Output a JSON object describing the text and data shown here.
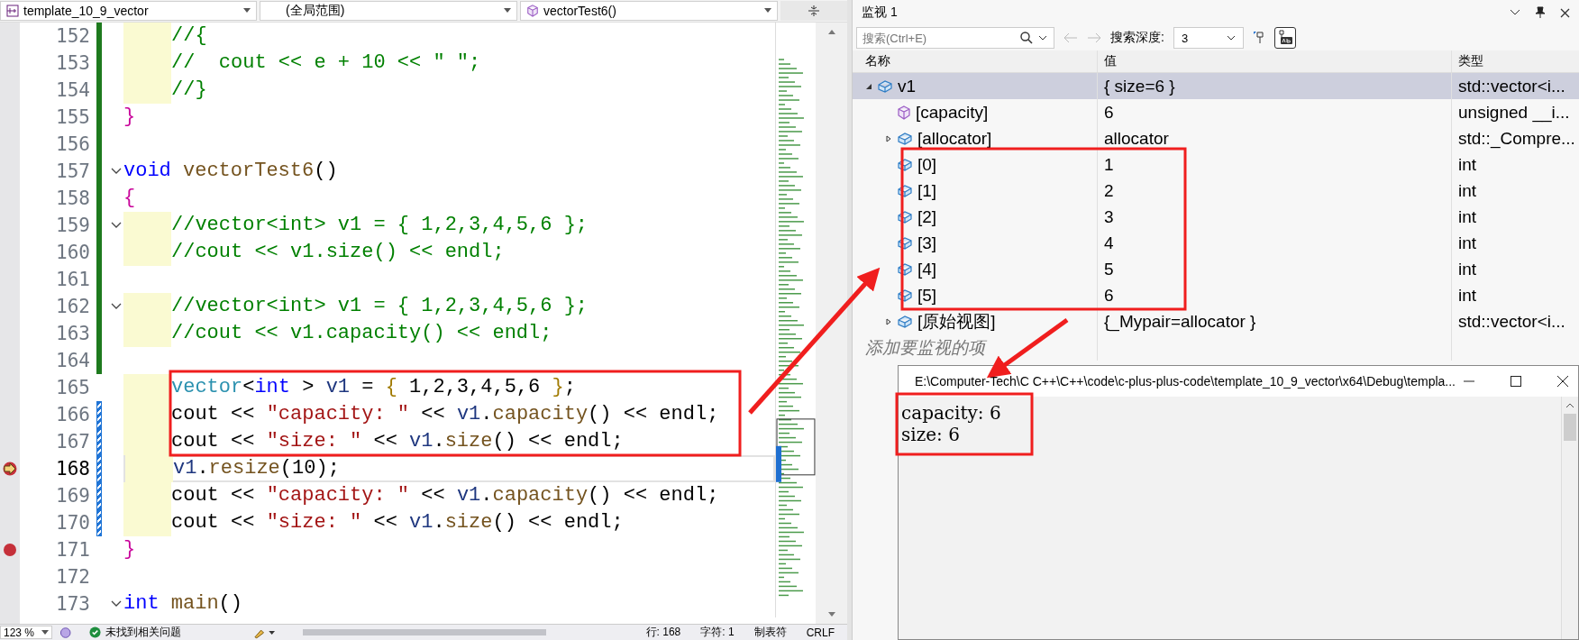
{
  "editor": {
    "nav": {
      "project": "template_10_9_vector",
      "scope": "(全局范围)",
      "member": "vectorTest6()"
    },
    "lines": [
      {
        "number": "152",
        "breakpoint": false,
        "changed": true,
        "saved": true,
        "fold": false,
        "indented": true,
        "current": false,
        "tokens": [
          {
            "kind": "comment",
            "text": "//{"
          }
        ]
      },
      {
        "number": "153",
        "breakpoint": false,
        "changed": true,
        "saved": true,
        "fold": false,
        "indented": true,
        "current": false,
        "tokens": [
          {
            "kind": "comment",
            "text": "//  cout << e + 10 << \" \";"
          }
        ]
      },
      {
        "number": "154",
        "breakpoint": false,
        "changed": true,
        "saved": true,
        "fold": false,
        "indented": true,
        "current": false,
        "tokens": [
          {
            "kind": "comment",
            "text": "//}"
          }
        ]
      },
      {
        "number": "155",
        "breakpoint": false,
        "changed": true,
        "saved": true,
        "fold": false,
        "indented": false,
        "current": false,
        "tokens": [
          {
            "kind": "brace",
            "text": "}"
          }
        ]
      },
      {
        "number": "156",
        "breakpoint": false,
        "changed": true,
        "saved": true,
        "fold": false,
        "indented": false,
        "current": false
      },
      {
        "number": "157",
        "breakpoint": false,
        "changed": true,
        "saved": true,
        "fold": true,
        "indented": false,
        "current": false,
        "tokens": [
          {
            "kind": "keyword",
            "text": "void"
          },
          {
            "kind": "function",
            "text": "vectorTest6"
          },
          {
            "kind": "plain",
            "text": "()"
          }
        ]
      },
      {
        "number": "158",
        "breakpoint": false,
        "changed": true,
        "saved": true,
        "fold": false,
        "indented": false,
        "current": false,
        "tokens": [
          {
            "kind": "brace",
            "text": "{"
          }
        ]
      },
      {
        "number": "159",
        "breakpoint": false,
        "changed": true,
        "saved": true,
        "fold": true,
        "indented": true,
        "current": false,
        "tokens": [
          {
            "kind": "comment",
            "text": "//vector<int> v1 = { 1,2,3,4,5,6 };"
          }
        ]
      },
      {
        "number": "160",
        "breakpoint": false,
        "changed": true,
        "saved": true,
        "fold": false,
        "indented": true,
        "current": false,
        "tokens": [
          {
            "kind": "comment",
            "text": "//cout << v1.size() << endl;"
          }
        ]
      },
      {
        "number": "161",
        "breakpoint": false,
        "changed": true,
        "saved": true,
        "fold": false,
        "indented": false,
        "current": false
      },
      {
        "number": "162",
        "breakpoint": false,
        "changed": true,
        "saved": true,
        "fold": true,
        "indented": true,
        "current": false,
        "tokens": [
          {
            "kind": "comment",
            "text": "//vector<int> v1 = { 1,2,3,4,5,6 };"
          }
        ]
      },
      {
        "number": "163",
        "breakpoint": false,
        "changed": true,
        "saved": true,
        "fold": false,
        "indented": true,
        "current": false,
        "tokens": [
          {
            "kind": "comment",
            "text": "//cout << v1.capacity() << endl;"
          }
        ]
      },
      {
        "number": "164",
        "breakpoint": false,
        "changed": true,
        "saved": true,
        "fold": false,
        "indented": false,
        "current": false
      },
      {
        "number": "165",
        "breakpoint": false,
        "changed": false,
        "fold": false,
        "indented": true,
        "current": false,
        "tokens": [
          {
            "kind": "type",
            "text": "vector"
          },
          {
            "kind": "plain",
            "text": "<"
          },
          {
            "kind": "keyword",
            "text": "int"
          },
          {
            "kind": "plain",
            "text": "> "
          },
          {
            "kind": "variable",
            "text": "v1"
          },
          {
            "kind": "plain",
            "text": " = "
          },
          {
            "kind": "init",
            "text": "{"
          },
          {
            "kind": "plain",
            "text": " 1,2,3,4,5,6 "
          },
          {
            "kind": "init",
            "text": "}"
          },
          {
            "kind": "plain",
            "text": ";"
          }
        ]
      },
      {
        "number": "166",
        "breakpoint": false,
        "changed": true,
        "saved": false,
        "fold": false,
        "indented": true,
        "current": false,
        "tokens": [
          {
            "kind": "plain",
            "text": "cout << "
          },
          {
            "kind": "string",
            "text": "\"capacity: \""
          },
          {
            "kind": "plain",
            "text": " << "
          },
          {
            "kind": "variable",
            "text": "v1"
          },
          {
            "kind": "plain",
            "text": "."
          },
          {
            "kind": "function",
            "text": "capacity"
          },
          {
            "kind": "plain",
            "text": "() << endl;"
          }
        ]
      },
      {
        "number": "167",
        "breakpoint": false,
        "changed": true,
        "saved": false,
        "fold": false,
        "indented": true,
        "current": false,
        "tokens": [
          {
            "kind": "plain",
            "text": "cout << "
          },
          {
            "kind": "string",
            "text": "\"size: \""
          },
          {
            "kind": "plain",
            "text": " << "
          },
          {
            "kind": "variable",
            "text": "v1"
          },
          {
            "kind": "plain",
            "text": "."
          },
          {
            "kind": "function",
            "text": "size"
          },
          {
            "kind": "plain",
            "text": "() << endl;"
          }
        ]
      },
      {
        "number": "168",
        "breakpoint": true,
        "changed": true,
        "saved": false,
        "fold": false,
        "indented": true,
        "current": true,
        "tokens": [
          {
            "kind": "variable",
            "text": "v1"
          },
          {
            "kind": "plain",
            "text": "."
          },
          {
            "kind": "function",
            "text": "resize"
          },
          {
            "kind": "plain",
            "text": "(10);"
          }
        ]
      },
      {
        "number": "169",
        "breakpoint": false,
        "changed": true,
        "saved": false,
        "fold": false,
        "indented": true,
        "current": false,
        "tokens": [
          {
            "kind": "plain",
            "text": "cout << "
          },
          {
            "kind": "string",
            "text": "\"capacity: \""
          },
          {
            "kind": "plain",
            "text": " << "
          },
          {
            "kind": "variable",
            "text": "v1"
          },
          {
            "kind": "plain",
            "text": "."
          },
          {
            "kind": "function",
            "text": "capacity"
          },
          {
            "kind": "plain",
            "text": "() << endl;"
          }
        ]
      },
      {
        "number": "170",
        "breakpoint": false,
        "changed": true,
        "saved": false,
        "fold": false,
        "indented": true,
        "current": false,
        "tokens": [
          {
            "kind": "plain",
            "text": "cout << "
          },
          {
            "kind": "string",
            "text": "\"size: \""
          },
          {
            "kind": "plain",
            "text": " << "
          },
          {
            "kind": "variable",
            "text": "v1"
          },
          {
            "kind": "plain",
            "text": "."
          },
          {
            "kind": "function",
            "text": "size"
          },
          {
            "kind": "plain",
            "text": "() << endl;"
          }
        ]
      },
      {
        "number": "171",
        "breakpoint": true,
        "changed": false,
        "fold": false,
        "indented": false,
        "current": false,
        "tokens": [
          {
            "kind": "brace",
            "text": "}"
          }
        ]
      },
      {
        "number": "172",
        "breakpoint": false,
        "changed": false,
        "fold": false,
        "indented": false,
        "current": false
      },
      {
        "number": "173",
        "breakpoint": false,
        "changed": false,
        "fold": true,
        "indented": false,
        "current": false,
        "tokens": [
          {
            "kind": "keyword",
            "text": "int"
          },
          {
            "kind": "function",
            "text": "main"
          },
          {
            "kind": "plain",
            "text": "()"
          }
        ]
      }
    ],
    "status_bar": {
      "zoom": "123 %",
      "issues": "未找到相关问题",
      "line": "行: 168",
      "char": "字符: 1",
      "indent_mode": "制表符",
      "line_ending": "CRLF"
    }
  },
  "watch": {
    "title": "监视 1",
    "search": {
      "placeholder": "搜索(Ctrl+E)"
    },
    "depth_label": "搜索深度:",
    "depth": "3",
    "columns": [
      "名称",
      "值",
      "类型"
    ],
    "rows": [
      {
        "name": "v1",
        "value": "{ size=6 }",
        "type": "std::vector<i...",
        "kind": "field",
        "expanded": true,
        "selected": true,
        "children": [
          {
            "name": "[capacity]",
            "value": "6",
            "type": "unsigned __i...",
            "kind": "property",
            "selected": false
          },
          {
            "name": "[allocator]",
            "value": "allocator",
            "type": "std::_Compre...",
            "kind": "field",
            "expanded": false,
            "selected": false
          },
          {
            "name": "[0]",
            "value": "1",
            "type": "int",
            "kind": "field",
            "selected": false
          },
          {
            "name": "[1]",
            "value": "2",
            "type": "int",
            "kind": "field",
            "selected": false
          },
          {
            "name": "[2]",
            "value": "3",
            "type": "int",
            "kind": "field",
            "selected": false
          },
          {
            "name": "[3]",
            "value": "4",
            "type": "int",
            "kind": "field",
            "selected": false
          },
          {
            "name": "[4]",
            "value": "5",
            "type": "int",
            "kind": "field",
            "selected": false
          },
          {
            "name": "[5]",
            "value": "6",
            "type": "int",
            "kind": "field",
            "selected": false
          },
          {
            "name": "[原始视图]",
            "value": "{_Mypair=allocator }",
            "type": "std::vector<i...",
            "kind": "field",
            "expanded": false,
            "selected": false
          }
        ]
      }
    ],
    "add_placeholder": "添加要监视的项"
  },
  "console": {
    "title": "E:\\Computer-Tech\\C C++\\C++\\code\\c-plus-plus-code\\template_10_9_vector\\x64\\Debug\\templa...",
    "lines": [
      "capacity: 6",
      "size: 6"
    ]
  }
}
